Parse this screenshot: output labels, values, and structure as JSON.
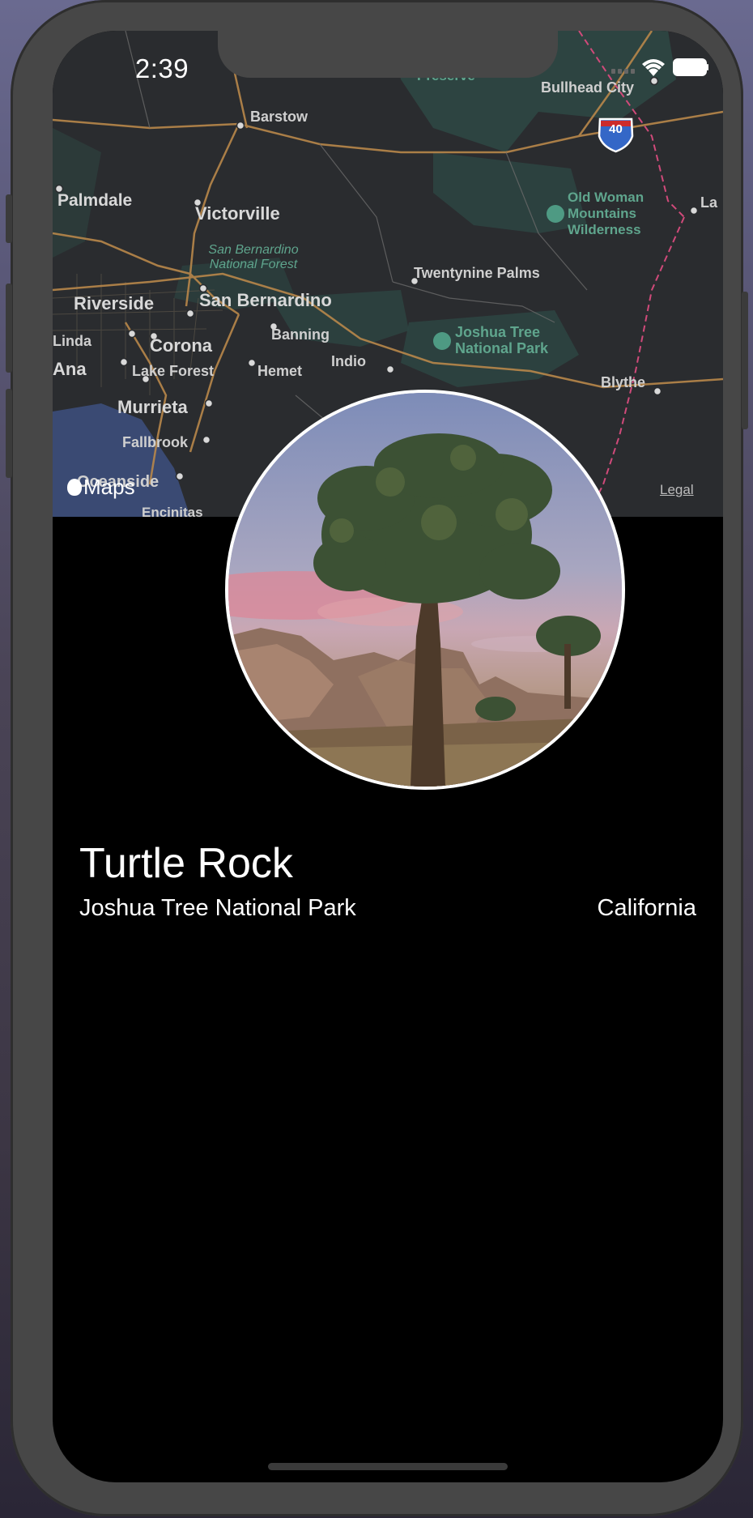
{
  "status_bar": {
    "time": "2:39"
  },
  "map": {
    "attribution": "Maps",
    "legal": "Legal",
    "cities": [
      "Barstow",
      "Bullhead City",
      "Palmdale",
      "Victorville",
      "Twentynine Palms",
      "Riverside",
      "San Bernardino",
      "Linda",
      "Corona",
      "Banning",
      "Indio",
      "Ana",
      "Lake Forest",
      "Hemet",
      "Blythe",
      "Murrieta",
      "Fallbrook",
      "Oceanside",
      "Encinitas",
      "Preserve",
      "La"
    ],
    "parks": [
      "San Bernardino National Forest",
      "Old Woman Mountains Wilderness",
      "Joshua Tree National Park"
    ],
    "highway": "40"
  },
  "landmark": {
    "name": "Turtle Rock",
    "park": "Joshua Tree National Park",
    "state": "California"
  },
  "colors": {
    "background": "#000000",
    "map_water": "#3a4a73",
    "map_land": "#2b2d30",
    "park_green": "#2c4a45",
    "road": "#b8874a"
  }
}
